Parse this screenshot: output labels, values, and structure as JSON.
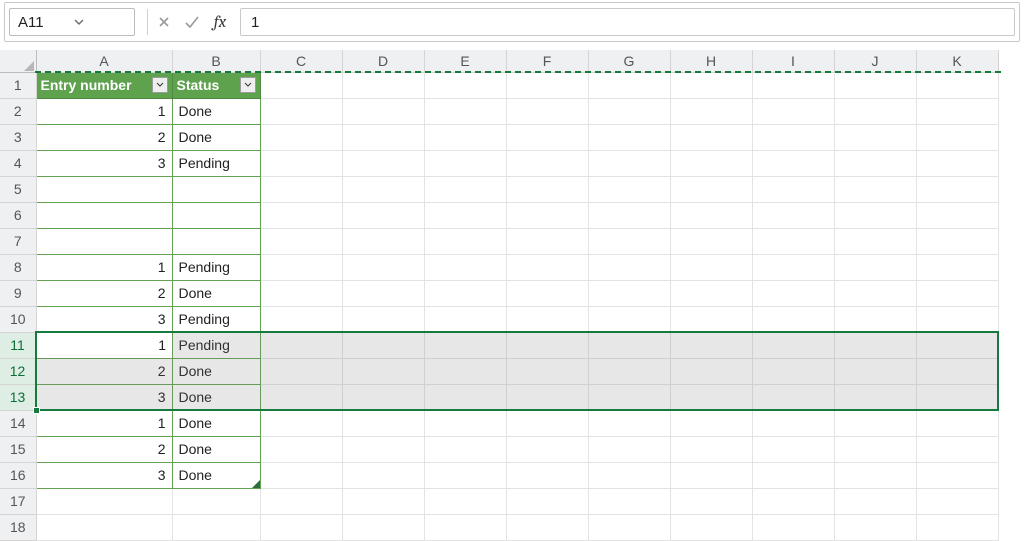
{
  "name_box": {
    "value": "A11"
  },
  "formula_bar": {
    "value": "1"
  },
  "columns": [
    "A",
    "B",
    "C",
    "D",
    "E",
    "F",
    "G",
    "H",
    "I",
    "J",
    "K"
  ],
  "row_count": 18,
  "selected_rows": [
    11,
    12,
    13
  ],
  "table": {
    "headers": {
      "a": "Entry number",
      "b": "Status"
    },
    "rows": [
      {
        "a": "1",
        "b": "Done"
      },
      {
        "a": "2",
        "b": "Done"
      },
      {
        "a": "3",
        "b": "Pending"
      },
      {
        "a": "",
        "b": ""
      },
      {
        "a": "",
        "b": ""
      },
      {
        "a": "",
        "b": ""
      },
      {
        "a": "1",
        "b": "Pending"
      },
      {
        "a": "2",
        "b": "Done"
      },
      {
        "a": "3",
        "b": "Pending"
      },
      {
        "a": "1",
        "b": "Pending"
      },
      {
        "a": "2",
        "b": "Done"
      },
      {
        "a": "3",
        "b": "Done"
      },
      {
        "a": "1",
        "b": "Done"
      },
      {
        "a": "2",
        "b": "Done"
      },
      {
        "a": "3",
        "b": "Done"
      }
    ]
  },
  "chart_data": {
    "type": "table",
    "title": "",
    "columns": [
      "Entry number",
      "Status"
    ],
    "rows": [
      [
        1,
        "Done"
      ],
      [
        2,
        "Done"
      ],
      [
        3,
        "Pending"
      ],
      [
        null,
        null
      ],
      [
        null,
        null
      ],
      [
        null,
        null
      ],
      [
        1,
        "Pending"
      ],
      [
        2,
        "Done"
      ],
      [
        3,
        "Pending"
      ],
      [
        1,
        "Pending"
      ],
      [
        2,
        "Done"
      ],
      [
        3,
        "Done"
      ],
      [
        1,
        "Done"
      ],
      [
        2,
        "Done"
      ],
      [
        3,
        "Done"
      ]
    ]
  }
}
